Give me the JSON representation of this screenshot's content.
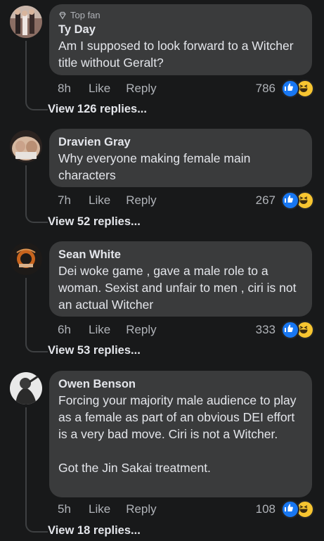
{
  "comments": [
    {
      "badge": "Top fan",
      "author": "Ty Day",
      "text": "Am I supposed to look forward to a Witcher title without Geralt?",
      "time": "8h",
      "like": "Like",
      "reply": "Reply",
      "reactions": "786",
      "view_replies": "View 126 replies..."
    },
    {
      "author": "Dravien Gray",
      "text": "Why everyone making female main characters",
      "time": "7h",
      "like": "Like",
      "reply": "Reply",
      "reactions": "267",
      "view_replies": "View 52 replies..."
    },
    {
      "author": "Sean White",
      "text": "Dei woke game , gave a male role to a woman. Sexist and unfair to men , ciri is not an actual Witcher",
      "time": "6h",
      "like": "Like",
      "reply": "Reply",
      "reactions": "333",
      "view_replies": "View 53 replies..."
    },
    {
      "author": "Owen Benson",
      "text": "Forcing your majority male audience to play as a female as part of an obvious DEI effort is a very bad move. Ciri is not a Witcher.\n\nGot the Jin Sakai treatment.",
      "time": "5h",
      "like": "Like",
      "reply": "Reply",
      "reactions": "108",
      "view_replies": "View 18 replies..."
    }
  ],
  "colors": {
    "background": "#18191a",
    "bubble": "#3a3b3c",
    "like_reaction": "#1877f2",
    "haha_reaction": "#f7c531"
  }
}
